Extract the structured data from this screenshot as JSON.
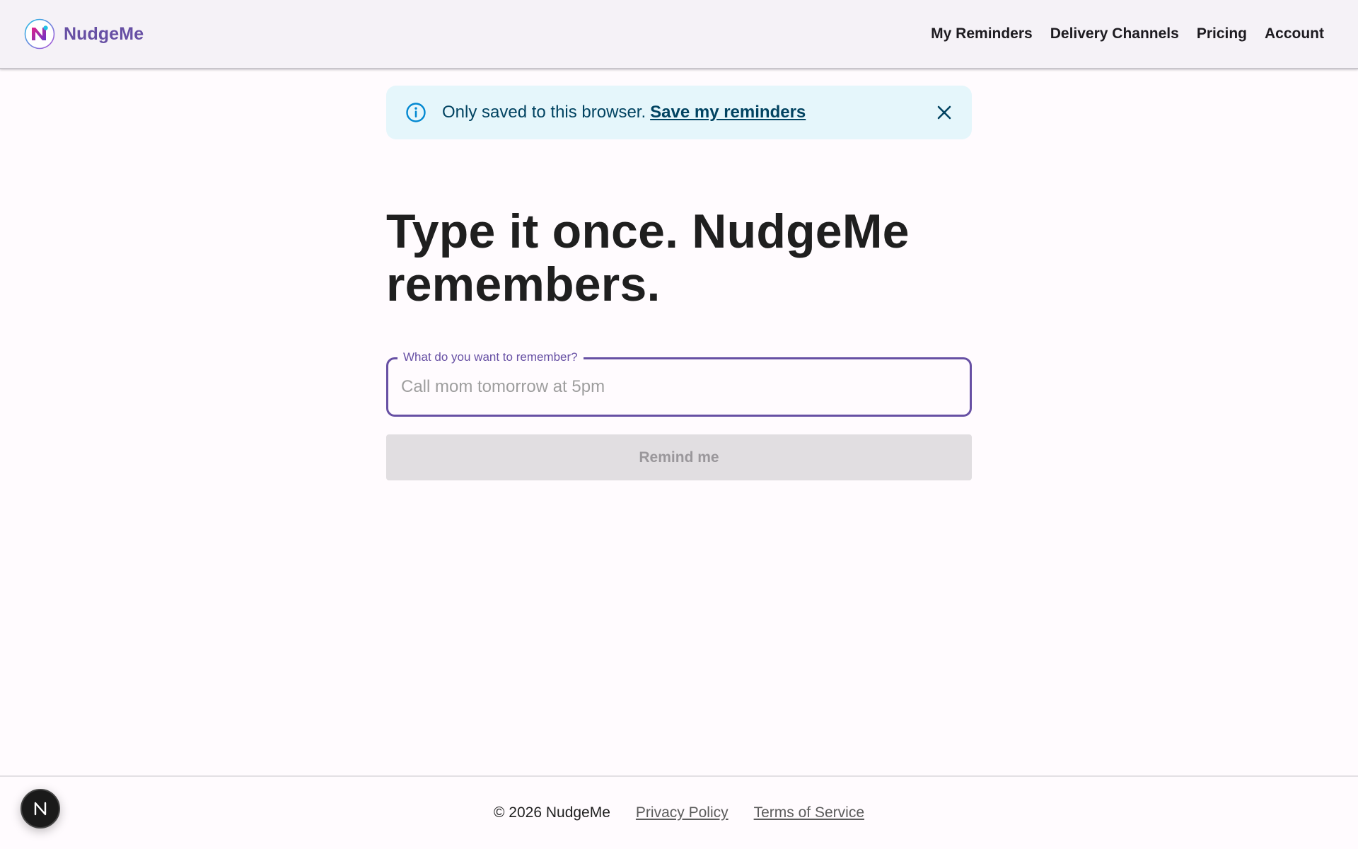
{
  "header": {
    "brand_name": "NudgeMe",
    "logo_icon": "nudgeme-logo-icon",
    "nav": [
      {
        "label": "My Reminders"
      },
      {
        "label": "Delivery Channels"
      },
      {
        "label": "Pricing"
      },
      {
        "label": "Account"
      }
    ]
  },
  "alert": {
    "icon": "info-circle-icon",
    "text": "Only saved to this browser.",
    "link_label": "Save my reminders",
    "close_icon": "close-icon"
  },
  "hero": {
    "title": "Type it once. NudgeMe remembers."
  },
  "reminder_form": {
    "field_label": "What do you want to remember?",
    "placeholder": "Call mom tomorrow at 5pm",
    "value": "",
    "submit_label": "Remind me",
    "submit_disabled": true
  },
  "footer": {
    "copyright": "© 2026 NudgeMe",
    "links": [
      {
        "label": "Privacy Policy"
      },
      {
        "label": "Terms of Service"
      }
    ]
  },
  "dev_badge": {
    "icon": "nextjs-devtools-icon"
  },
  "colors": {
    "primary": "#6750a4",
    "alert_bg": "#e5f6fb",
    "alert_text": "#014361",
    "alert_icon": "#0288d1",
    "disabled_bg": "#e1dee1"
  }
}
